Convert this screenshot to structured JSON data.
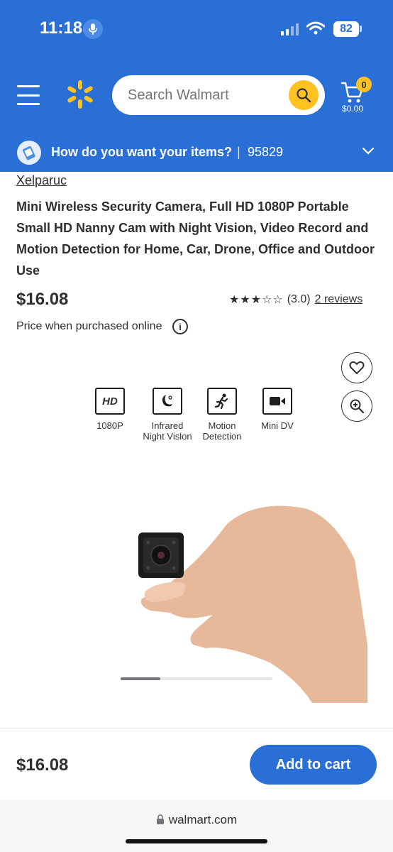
{
  "status_bar": {
    "time": "11:18",
    "battery": "82"
  },
  "header": {
    "search_placeholder": "Search Walmart",
    "cart_count": "0",
    "cart_total": "$0.00"
  },
  "fulfillment": {
    "prompt": "How do you want your items?",
    "separator": "|",
    "zip": "95829"
  },
  "product": {
    "brand": "Xelparuc",
    "title": "Mini Wireless Security Camera, Full HD 1080P Portable Small HD Nanny Cam with Night Vision, Video Record and Motion Detection for Home, Car, Drone, Office and Outdoor Use",
    "price": "$16.08",
    "rating_value": "(3.0)",
    "rating_stars": 3,
    "reviews": "2 reviews",
    "price_note": "Price when purchased online",
    "image_features": [
      {
        "icon": "hd-icon",
        "label_line1": "1080P",
        "label_line2": ""
      },
      {
        "icon": "night-vision-icon",
        "label_line1": "Infrared",
        "label_line2": "Night Vislon"
      },
      {
        "icon": "motion-detection-icon",
        "label_line1": "Motion",
        "label_line2": "Detection"
      },
      {
        "icon": "mini-dv-icon",
        "label_line1": "Mini DV",
        "label_line2": ""
      }
    ],
    "hd_badge_text": "HD",
    "carousel_position": 0.26
  },
  "bottom_bar": {
    "price": "$16.08",
    "add_to_cart": "Add to cart"
  },
  "browser": {
    "url": "walmart.com"
  },
  "colors": {
    "brand_blue": "#2a6fd6",
    "spark_yellow": "#ffc220"
  }
}
